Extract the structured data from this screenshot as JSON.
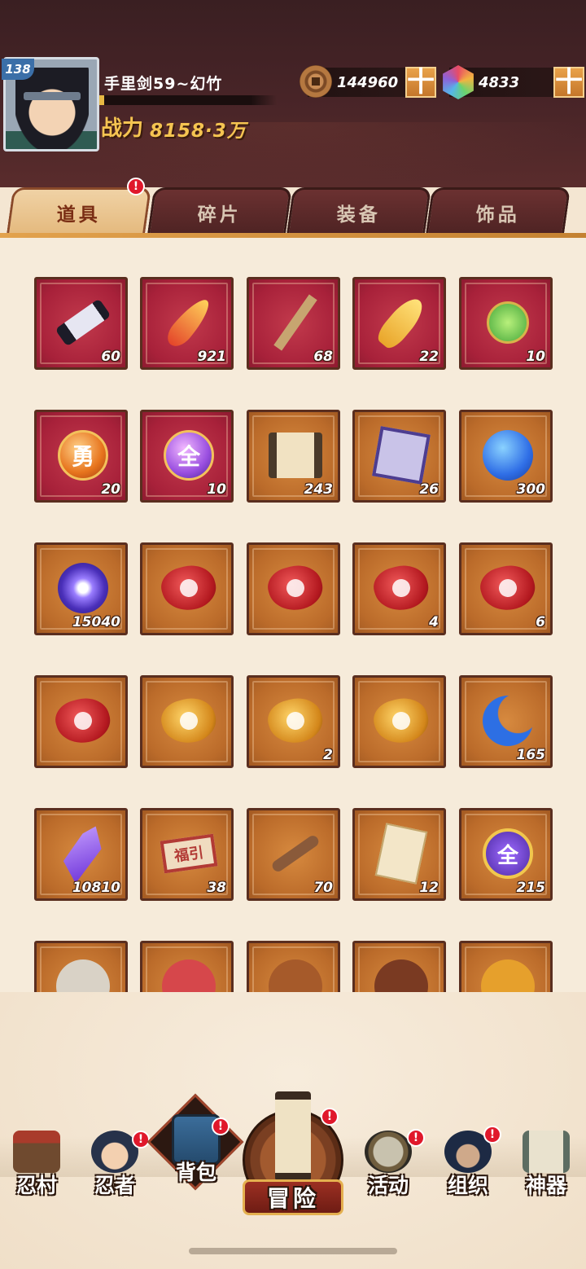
{
  "player": {
    "level": "138",
    "name": "手里剑59~幻竹",
    "power_label": "战力",
    "power_value": "8158·3万"
  },
  "currency": {
    "coins": "144960",
    "gems": "4833",
    "add_label": "十"
  },
  "tabs": [
    {
      "label": "道具",
      "active": true,
      "alert": "!"
    },
    {
      "label": "碎片",
      "active": false
    },
    {
      "label": "装备",
      "active": false
    },
    {
      "label": "饰品",
      "active": false
    }
  ],
  "items": [
    {
      "icon": "scroll-icon",
      "count": "60",
      "bg": "red"
    },
    {
      "icon": "phoenix-feather-icon",
      "count": "921",
      "bg": "red"
    },
    {
      "icon": "wooden-stick-icon",
      "count": "68",
      "bg": "red"
    },
    {
      "icon": "golden-fan-icon",
      "count": "22",
      "bg": "red"
    },
    {
      "icon": "jade-pendant-icon",
      "count": "10",
      "bg": "red"
    },
    {
      "icon": "courage-orb-icon",
      "glyph": "勇",
      "count": "20",
      "bg": "red"
    },
    {
      "icon": "all-orb-icon",
      "glyph": "全",
      "count": "10",
      "bg": "red"
    },
    {
      "icon": "map-scroll-icon",
      "count": "243",
      "bg": "gold"
    },
    {
      "icon": "cloth-seal-icon",
      "count": "26",
      "bg": "gold"
    },
    {
      "icon": "blue-orb-icon",
      "count": "300",
      "bg": "gold"
    },
    {
      "icon": "chakra-orb-icon",
      "count": "15040",
      "bg": "gold"
    },
    {
      "icon": "red-stone-fire-icon",
      "count": "",
      "bg": "gold"
    },
    {
      "icon": "red-stone-figure-icon",
      "count": "",
      "bg": "gold"
    },
    {
      "icon": "red-stone-fist-icon",
      "count": "4",
      "bg": "gold"
    },
    {
      "icon": "red-stone-target-icon",
      "count": "6",
      "bg": "gold"
    },
    {
      "icon": "red-stone-eye-icon",
      "count": "",
      "bg": "gold"
    },
    {
      "icon": "gold-stone-hand-icon",
      "count": "",
      "bg": "gold"
    },
    {
      "icon": "gold-stone-flame-icon",
      "count": "2",
      "bg": "gold"
    },
    {
      "icon": "gold-stone-wind-icon",
      "count": "",
      "bg": "gold"
    },
    {
      "icon": "blue-moon-icon",
      "count": "165",
      "bg": "gold"
    },
    {
      "icon": "purple-crystal-icon",
      "count": "10810",
      "bg": "gold"
    },
    {
      "icon": "fortune-banner-icon",
      "glyph": "福引",
      "count": "38",
      "bg": "gold"
    },
    {
      "icon": "key-icon",
      "count": "70",
      "bg": "gold"
    },
    {
      "icon": "paper-talisman-icon",
      "count": "12",
      "bg": "gold"
    },
    {
      "icon": "all-badge-icon",
      "glyph": "全",
      "count": "215",
      "bg": "gold"
    },
    {
      "icon": "shuriken-icon",
      "count": "",
      "bg": "gold"
    },
    {
      "icon": "red-fan-icon",
      "count": "",
      "bg": "gold"
    },
    {
      "icon": "rope-icon",
      "count": "",
      "bg": "gold"
    },
    {
      "icon": "gourd-icon",
      "count": "",
      "bg": "gold"
    },
    {
      "icon": "jar-icon",
      "count": "",
      "bg": "gold"
    }
  ],
  "nav": {
    "village": "忍村",
    "ninja": "忍者",
    "bag": "背包",
    "adventure": "冒险",
    "event": "活动",
    "org": "组织",
    "artifact": "神器",
    "alert": "!"
  },
  "colors": {
    "header_bg": "#3a1f22",
    "active_tab": "#e4b97d",
    "item_red": "#a8213a",
    "item_gold": "#bb6b2a",
    "alert": "#e0182b"
  }
}
